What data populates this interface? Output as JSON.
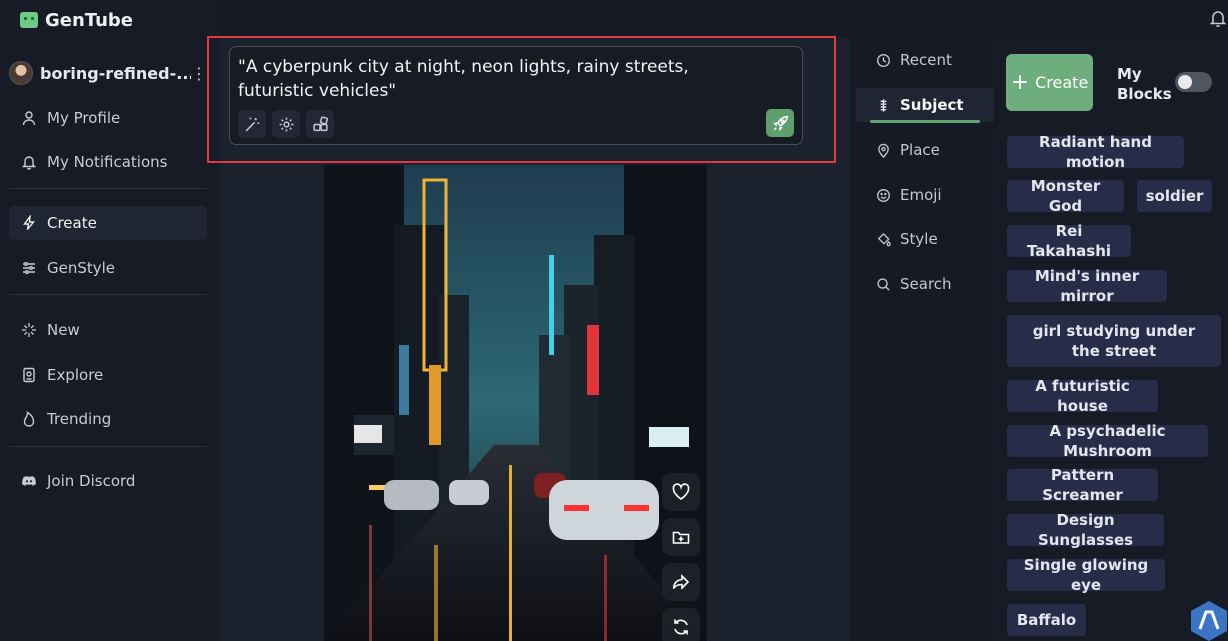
{
  "app": {
    "title": "GenTube"
  },
  "user": {
    "name": "boring-refined-..."
  },
  "sidebar": {
    "items": [
      {
        "id": "my-profile",
        "label": "My Profile"
      },
      {
        "id": "my-notifications",
        "label": "My Notifications"
      },
      {
        "id": "create",
        "label": "Create",
        "active": true
      },
      {
        "id": "genstyle",
        "label": "GenStyle"
      },
      {
        "id": "new",
        "label": "New"
      },
      {
        "id": "explore",
        "label": "Explore"
      },
      {
        "id": "trending",
        "label": "Trending"
      },
      {
        "id": "join-discord",
        "label": "Join Discord"
      }
    ]
  },
  "prompt": {
    "text": "\"A cyberpunk city at night, neon lights, rainy streets, futuristic vehicles\""
  },
  "categories": [
    {
      "label": "Recent",
      "icon": "clock-icon"
    },
    {
      "label": "Subject",
      "icon": "subject-icon",
      "active": true
    },
    {
      "label": "Place",
      "icon": "pin-icon"
    },
    {
      "label": "Emoji",
      "icon": "emoji-icon"
    },
    {
      "label": "Style",
      "icon": "paint-bucket-icon"
    },
    {
      "label": "Search",
      "icon": "search-icon"
    }
  ],
  "blocks": {
    "create_label": "Create",
    "my_blocks_label": "My Blocks",
    "my_blocks_enabled": false,
    "chips": [
      "Radiant hand motion",
      "Monster God",
      "soldier",
      "Rei Takahashi",
      "Mind's inner mirror",
      "girl studying under the street",
      "A futuristic house",
      "A psychadelic Mushroom",
      "Pattern Screamer",
      "Design Sunglasses",
      "Single glowing eye",
      "Baffalo"
    ]
  },
  "colors": {
    "accent": "#6ead7c",
    "highlight_border": "#e0393e",
    "chip_bg": "#272c48"
  }
}
